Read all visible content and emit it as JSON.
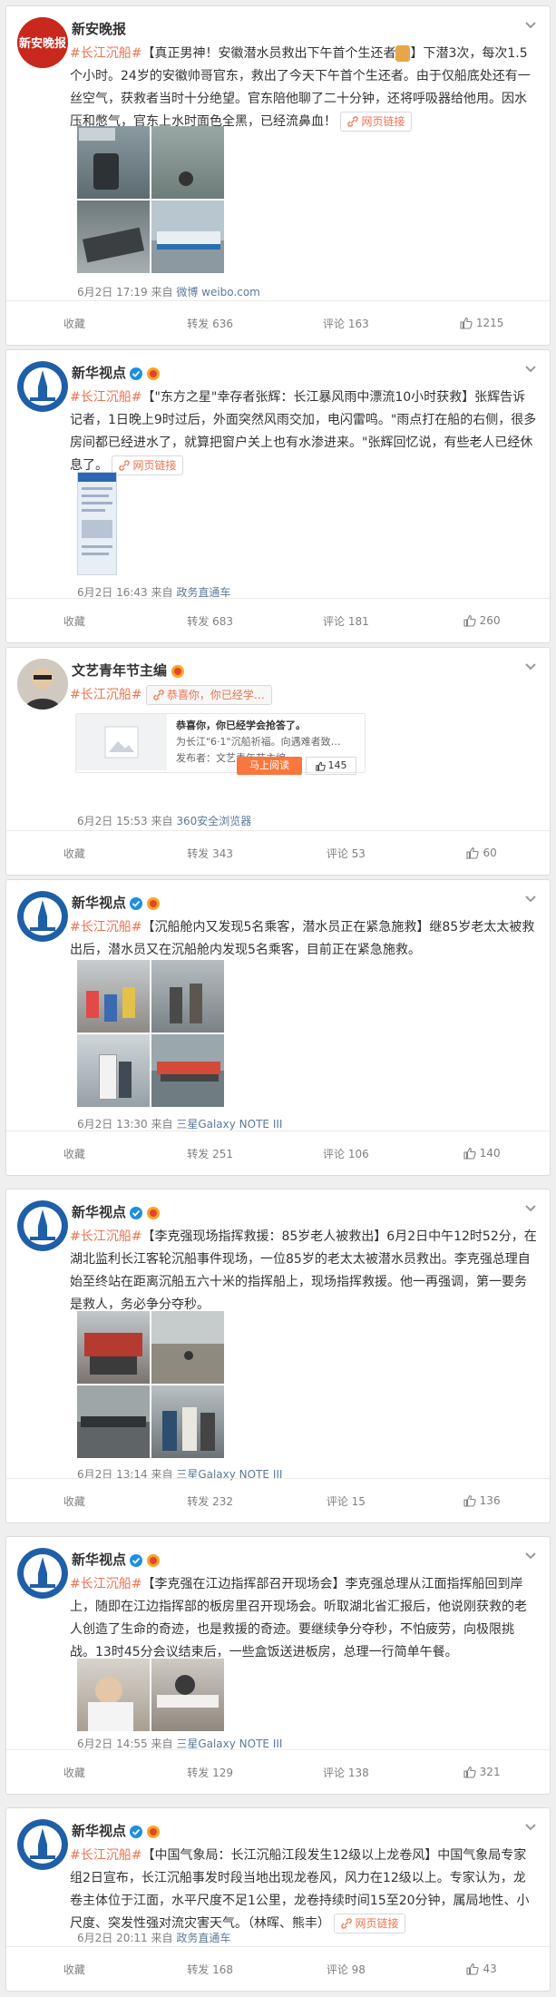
{
  "posts": [
    {
      "author": "新安晚报",
      "verified": false,
      "medal": false,
      "tag": "#长江沉船#",
      "title": "【真正男神！安徽潜水员救出下午首个生还者",
      "title_suffix": "】",
      "text": "下潜3次，每次1.5个小时。24岁的安徽帅哥官东，救出了今天下午首个生还者。由于仅船底处还有一丝空气，获救者当时十分绝望。官东陪他聊了二十分钟，还将呼吸器给他用。因水压和憋气，官东上水时面色全黑，已经流鼻血！",
      "link": "网页链接",
      "time": "6月2日 17:19 来自",
      "source": "微博 weibo.com",
      "actions": {
        "fav": "收藏",
        "repost": "转发 636",
        "comment": "评论 163",
        "like": "1215"
      },
      "avatar_text": "新安晚报"
    },
    {
      "author": "新华视点",
      "verified": true,
      "medal": true,
      "tag": "#长江沉船#",
      "title": "【\"东方之星\"幸存者张辉：长江暴风雨中漂流10小时获救】",
      "text": "张辉告诉记者，1日晚上9时过后，外面突然风雨交加，电闪雷鸣。\"雨点打在船的右侧，很多房间都已经进水了，就算把窗户关上也有水渗进来。\"张辉回忆说，有些老人已经休息了。",
      "link": "网页链接",
      "time": "6月2日 16:43 来自",
      "source": "政务直通车",
      "actions": {
        "fav": "收藏",
        "repost": "转发 683",
        "comment": "评论 181",
        "like": "260"
      }
    },
    {
      "author": "文艺青年节主编",
      "verified": false,
      "medal": true,
      "tag": "#长江沉船#",
      "link": "恭喜你，你已经学…",
      "card": {
        "title": "恭喜你，你已经学会抢答了。",
        "desc": "为长江\"6·1\"沉船祈福。向遇难者致…",
        "publisher": "发布者：文艺青年节主编",
        "read_btn": "马上阅读",
        "likes": "145"
      },
      "time": "6月2日 15:53 来自",
      "source": "360安全浏览器",
      "actions": {
        "fav": "收藏",
        "repost": "转发 343",
        "comment": "评论 53",
        "like": "60"
      }
    },
    {
      "author": "新华视点",
      "verified": true,
      "medal": true,
      "tag": "#长江沉船#",
      "title": "【沉船舱内又发现5名乘客，潜水员正在紧急施救】",
      "text": "继85岁老太太被救出后，潜水员又在沉船舱内发现5名乘客，目前正在紧急施救。",
      "time": "6月2日 13:30 来自",
      "source": "三星Galaxy NOTE III",
      "actions": {
        "fav": "收藏",
        "repost": "转发 251",
        "comment": "评论 106",
        "like": "140"
      }
    },
    {
      "author": "新华视点",
      "verified": true,
      "medal": true,
      "tag": "#长江沉船#",
      "title": "【李克强现场指挥救援：85岁老人被救出】",
      "text": "6月2日中午12时52分，在湖北监利长江客轮沉船事件现场，一位85岁的老太太被潜水员救出。李克强总理自始至终站在距离沉船五六十米的指挥船上，现场指挥救援。他一再强调，第一要务是救人，务必争分夺秒。",
      "time": "6月2日 13:14 来自",
      "source": "三星Galaxy NOTE III",
      "actions": {
        "fav": "收藏",
        "repost": "转发 232",
        "comment": "评论 15",
        "like": "136"
      }
    },
    {
      "author": "新华视点",
      "verified": true,
      "medal": true,
      "tag": "#长江沉船#",
      "title": "【李克强在江边指挥部召开现场会】",
      "text": "李克强总理从江面指挥船回到岸上，随即在江边指挥部的板房里召开现场会。听取湖北省汇报后，他说刚获救的老人创造了生命的奇迹，也是救援的奇迹。要继续争分夺秒，不怕疲劳，向极限挑战。13时45分会议结束后，一些盒饭送进板房，总理一行简单午餐。",
      "time": "6月2日 14:55 来自",
      "source": "三星Galaxy NOTE III",
      "actions": {
        "fav": "收藏",
        "repost": "转发 129",
        "comment": "评论 138",
        "like": "321"
      }
    },
    {
      "author": "新华视点",
      "verified": true,
      "medal": true,
      "tag": "#长江沉船#",
      "title": "【中国气象局：长江沉船江段发生12级以上龙卷风】",
      "text": "中国气象局专家组2日宣布，长江沉船事发时段当地出现龙卷风，风力在12级以上。专家认为，龙卷主体位于江面，水平尺度不足1公里，龙卷持续时间15至20分钟，属局地性、小尺度、突发性强对流灾害天气。（林晖、熊丰）",
      "link": "网页链接",
      "time": "6月2日 20:11 来自",
      "source": "政务直通车",
      "actions": {
        "fav": "收藏",
        "repost": "转发 168",
        "comment": "评论 98",
        "like": "43"
      }
    }
  ]
}
